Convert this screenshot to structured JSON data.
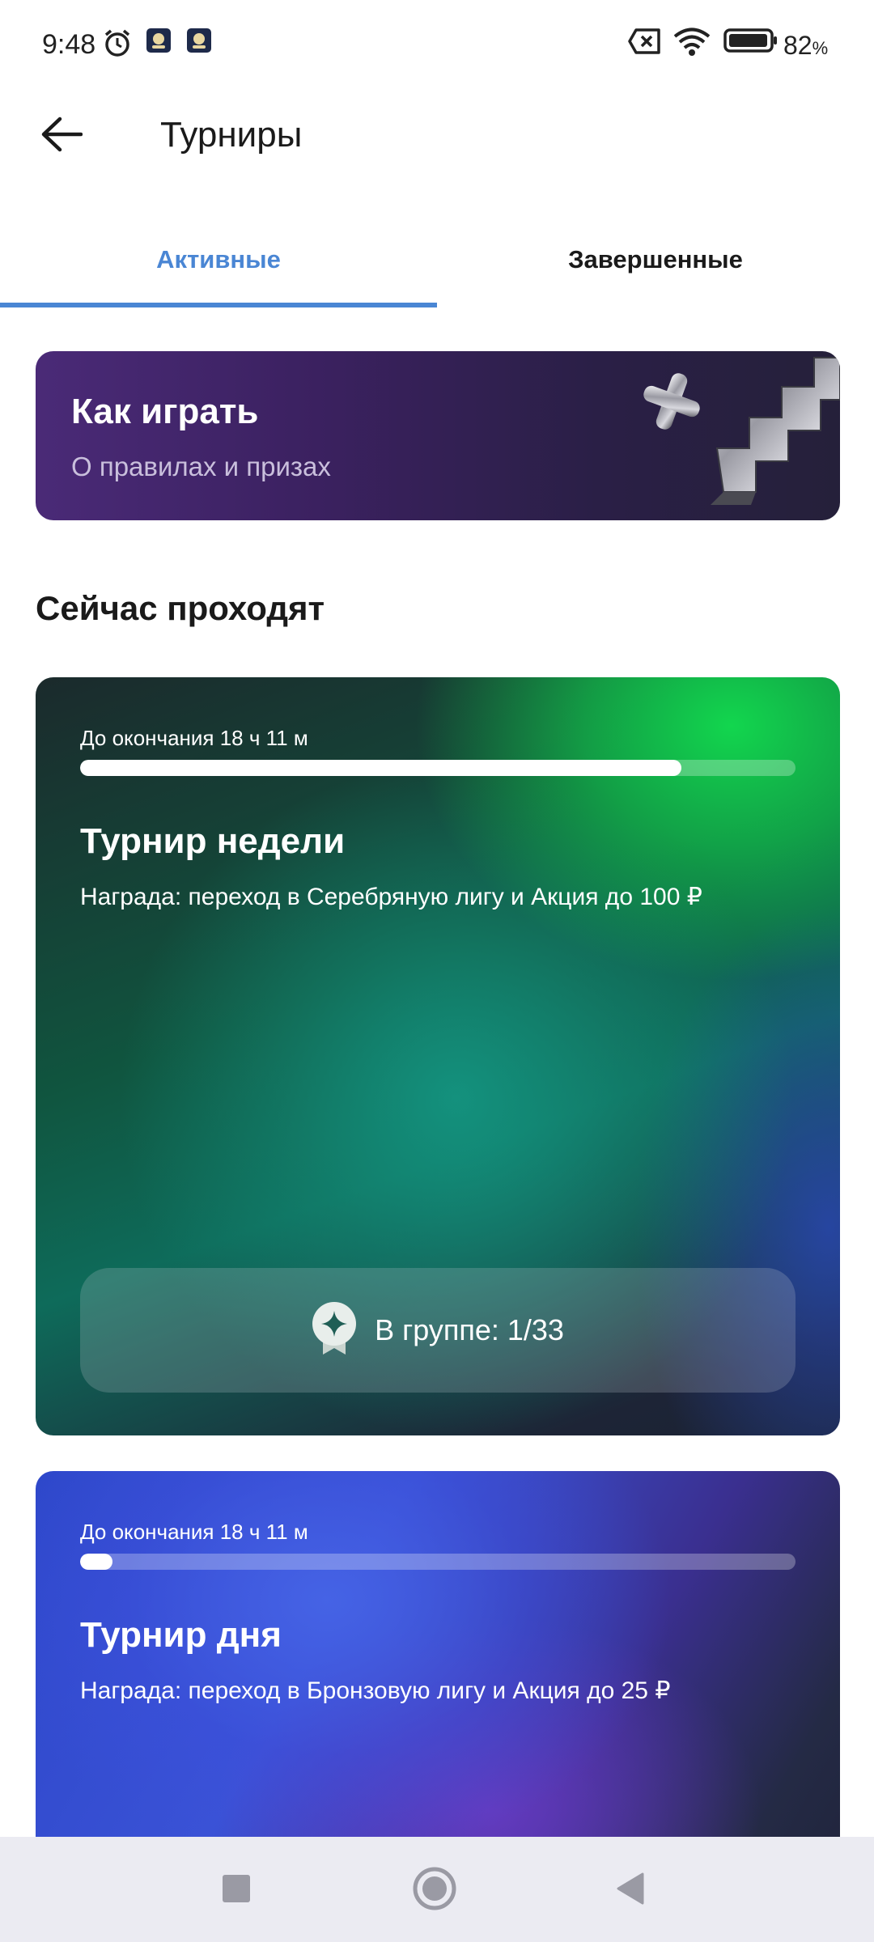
{
  "status_bar": {
    "time": "9:48",
    "battery_percent": "82",
    "battery_unit": "%",
    "icons": [
      "alarm-icon",
      "app-notification-icon",
      "app-notification-icon",
      "sim-error-icon",
      "wifi-icon",
      "battery-icon"
    ]
  },
  "header": {
    "back_icon": "arrow-left-icon",
    "title": "Турниры"
  },
  "tabs": [
    {
      "label": "Активные",
      "active": true
    },
    {
      "label": "Завершенные",
      "active": false
    }
  ],
  "howto": {
    "title": "Как играть",
    "subtitle": "О правилах и призах"
  },
  "section_title": "Сейчас проходят",
  "tournaments": [
    {
      "timer": "До окончания 18 ч 11 м",
      "progress": 0.84,
      "title": "Турнир недели",
      "prize": "Награда: переход в Серебряную лигу и Акция до 100 ₽",
      "group_label": "В группе: 1/33"
    },
    {
      "timer": "До окончания 18 ч 11 м",
      "progress": 0.045,
      "title": "Турнир дня",
      "prize": "Награда: переход в Бронзовую лигу и Акция до 25 ₽"
    }
  ],
  "colors": {
    "accent": "#4a86d4",
    "howto_bg": "#3b2160",
    "week_card_green": "#12d64e",
    "day_card_blue": "#3a52d6",
    "nav_bar_bg": "#ebebf2"
  },
  "nav_bar": {
    "buttons": [
      "recents-square-icon",
      "home-circle-icon",
      "back-triangle-icon"
    ]
  }
}
